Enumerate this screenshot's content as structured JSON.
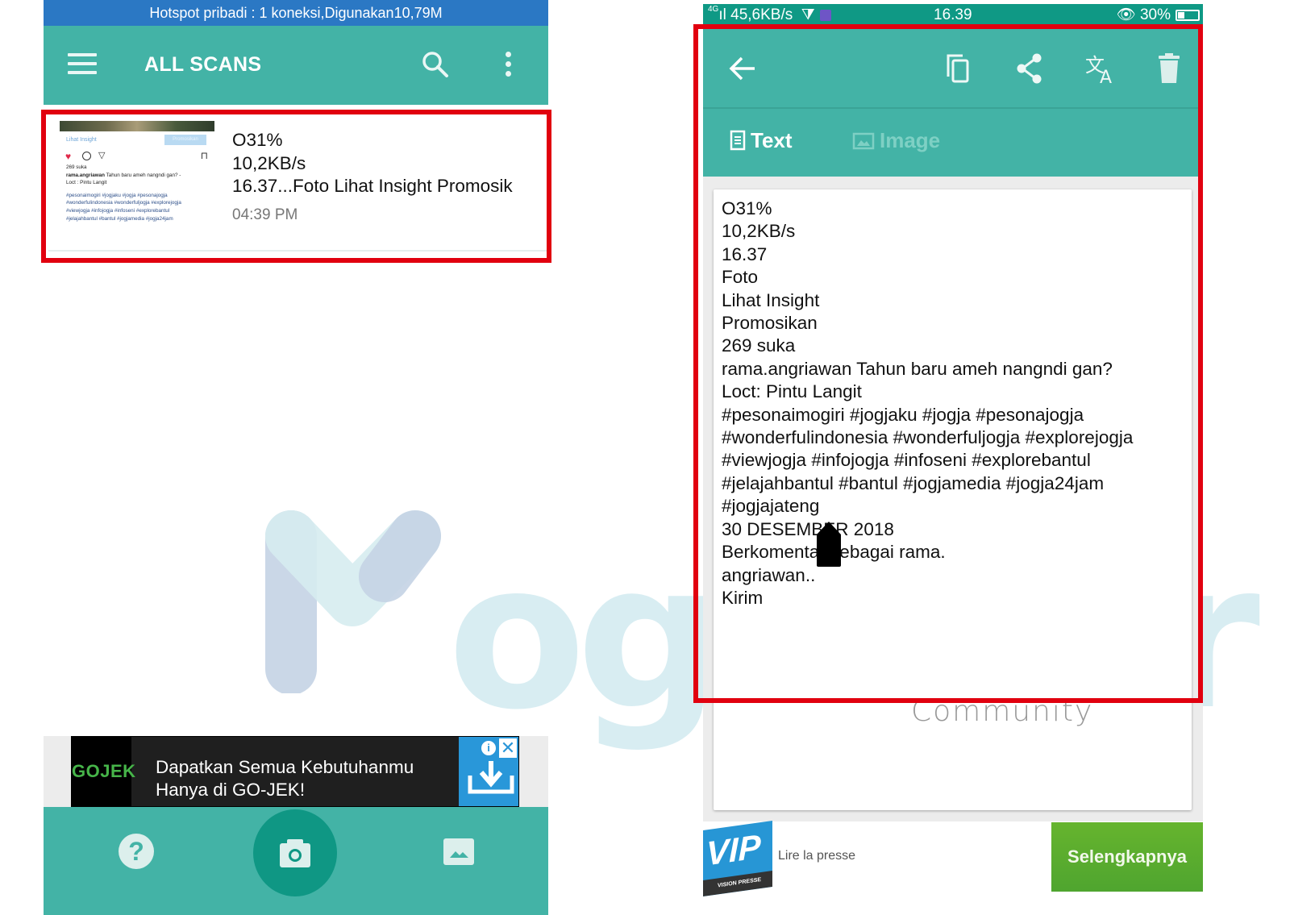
{
  "left_phone": {
    "hotspot_bar": "Hotspot pribadi : 1 koneksi,Digunakan10,79M",
    "appbar": {
      "title": "ALL SCANS",
      "icons": [
        "hamburger-menu-icon",
        "search-icon",
        "more-vert-icon"
      ]
    },
    "scan_item": {
      "lines": [
        "O31%",
        "10,2KB/s",
        "16.37...Foto Lihat Insight Promosik"
      ],
      "time": "04:39 PM",
      "thumbnail": {
        "insight": "Lihat Insight",
        "promo": "Promosikan",
        "likes": "269 suka",
        "caption_user": "rama.angriawan",
        "caption_text": " Tahun baru ameh nangndi gan? -",
        "location": "Loct : Pintu Langit",
        "dash": "-",
        "tags": [
          "#pesonaimogiri #jogjaku #jogja #pesonajogja",
          "#wonderfulindonesia #wonderfuljogja #explorejogja",
          "#viewjogja #infojogja #infoseni #explorebantul",
          "#jelajahbantul #bantul #jogjamedia #jogja24jam"
        ]
      }
    },
    "ad": {
      "brand": "GOJEK",
      "line1": "Dapatkan Semua Kebutuhanmu",
      "line2": "Hanya di GO-JEK!",
      "info": "i",
      "close": "✕"
    },
    "bottom_bar": {
      "help": "?",
      "icons": [
        "help-icon",
        "camera-icon",
        "gallery-icon"
      ]
    }
  },
  "right_phone": {
    "status_bar": {
      "signal": "4G",
      "speed": "45,6KB/s",
      "time": "16.39",
      "battery": "30%",
      "battery_level": 0.3
    },
    "appbar": {
      "icons": [
        "back-arrow-icon",
        "copy-icon",
        "share-icon",
        "translate-icon",
        "delete-icon"
      ]
    },
    "tabs": [
      {
        "label": "Text",
        "active": true
      },
      {
        "label": "Image",
        "active": false
      }
    ],
    "ocr_lines": [
      "O31%",
      "10,2KB/s",
      "16.37",
      "Foto",
      "Lihat Insight",
      "Promosikan",
      "269 suka",
      "rama.angriawan Tahun baru ameh nangndi gan?",
      "Loct: Pintu Langit",
      "#pesonaimogiri #jogjaku #jogja #pesonajogja",
      "#wonderfulindonesia #wonderfuljogja #explorejogja",
      "#viewjogja #infojogja #infoseni #explorebantul",
      "#jelajahbantul #bantul #jogjamedia #jogja24jam",
      "#jogjajateng",
      "30 DESEMBER 2018",
      "Berkomentar sebagai rama.",
      "angriawan..",
      "Kirim"
    ],
    "ad": {
      "logo": "VIP",
      "logo_sub": "VISION PRESSE",
      "caption": "Lire la presse",
      "cta": "Selengkapnya"
    }
  },
  "watermark": {
    "brand": "oglo",
    "brand_tail": "ger",
    "community": "Community"
  },
  "colors": {
    "teal": "#43b3a6",
    "status_teal": "#0f9985",
    "hotspot_blue": "#2b78c4",
    "highlight_red": "#e1000f",
    "cta_green": "#5aad2f"
  }
}
